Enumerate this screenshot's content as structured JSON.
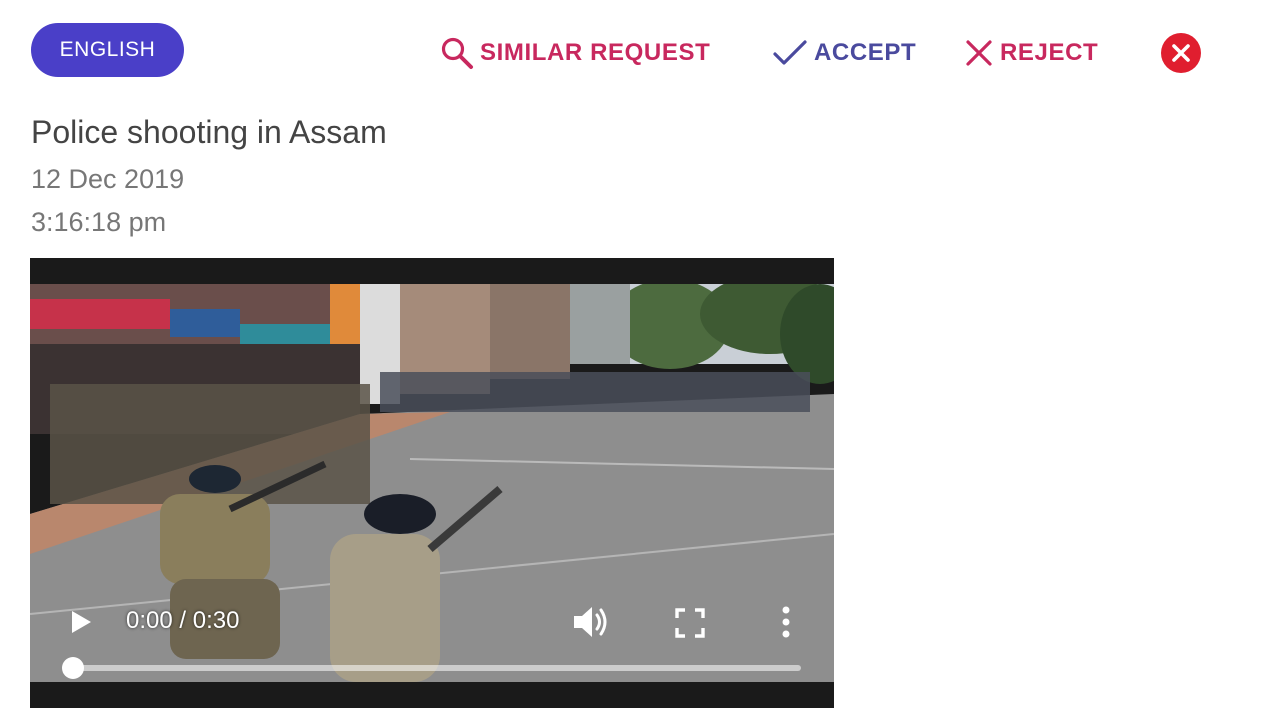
{
  "language": {
    "label": "ENGLISH",
    "color": "#4a3fc8"
  },
  "toolbar": {
    "similar_label": "SIMILAR REQUEST",
    "similar_icon": "search-icon",
    "accept_label": "ACCEPT",
    "accept_icon": "check-icon",
    "reject_label": "REJECT",
    "reject_icon": "x-icon",
    "close_icon": "close-circle-icon",
    "colors": {
      "pink": "#c8285e",
      "indigo": "#4a4a9e",
      "close_red": "#e01e2f"
    }
  },
  "post": {
    "title": "Police shooting in Assam",
    "date": "12 Dec 2019",
    "time": "3:16:18 pm"
  },
  "video": {
    "current_time": "0:00",
    "duration": "0:30",
    "time_display": "0:00 / 0:30",
    "progress_fraction": 0.0,
    "icons": {
      "play": "play-icon",
      "volume": "volume-icon",
      "fullscreen": "fullscreen-icon",
      "more": "more-vert-icon"
    }
  }
}
